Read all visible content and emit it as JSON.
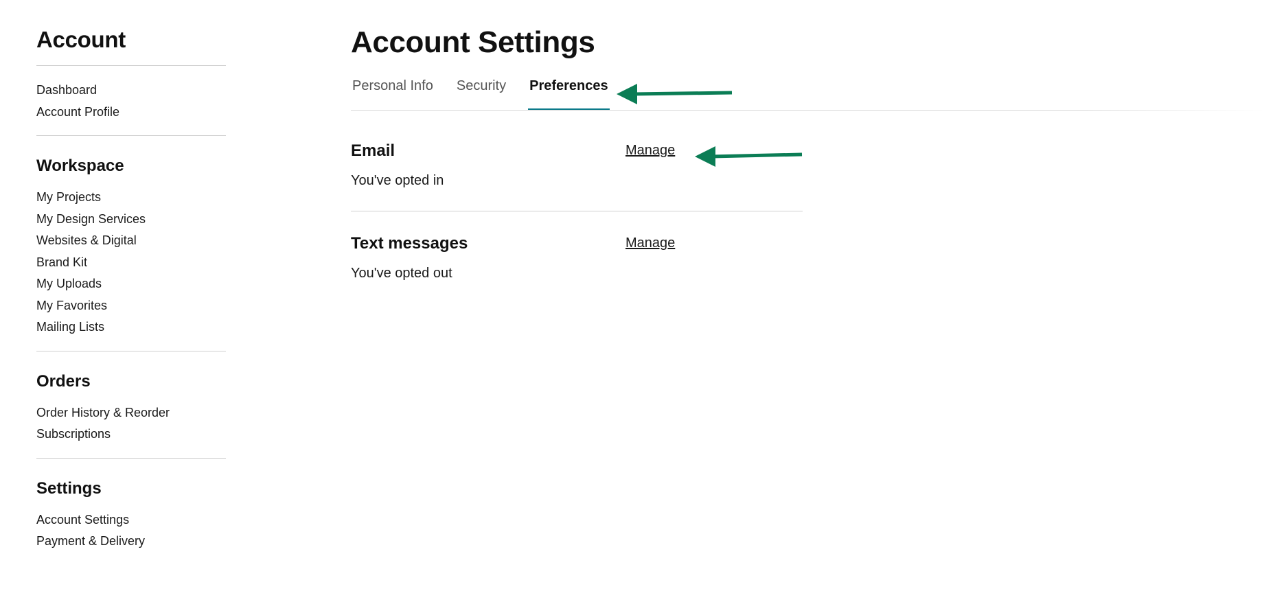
{
  "sidebar": {
    "account": {
      "title": "Account",
      "items": [
        "Dashboard",
        "Account Profile"
      ]
    },
    "workspace": {
      "title": "Workspace",
      "items": [
        "My Projects",
        "My Design Services",
        "Websites & Digital",
        "Brand Kit",
        "My Uploads",
        "My Favorites",
        "Mailing Lists"
      ]
    },
    "orders": {
      "title": "Orders",
      "items": [
        "Order History & Reorder",
        "Subscriptions"
      ]
    },
    "settings": {
      "title": "Settings",
      "items": [
        "Account Settings",
        "Payment & Delivery"
      ]
    }
  },
  "main": {
    "title": "Account Settings",
    "tabs": [
      {
        "label": "Personal Info",
        "active": false
      },
      {
        "label": "Security",
        "active": false
      },
      {
        "label": "Preferences",
        "active": true
      }
    ],
    "preferences": [
      {
        "title": "Email",
        "link": "Manage",
        "status": "You've opted in"
      },
      {
        "title": "Text messages",
        "link": "Manage",
        "status": "You've opted out"
      }
    ]
  },
  "colors": {
    "tab_underline": "#0b7a8a",
    "annotation_arrow": "#0b7d55"
  },
  "annotations": {
    "icon": "arrow-left-icon",
    "count": 2
  }
}
